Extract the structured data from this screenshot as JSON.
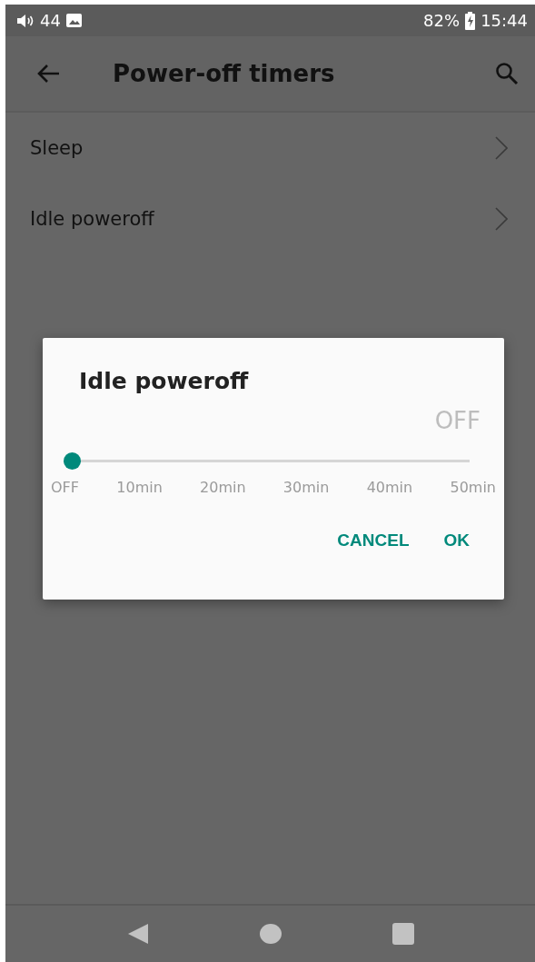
{
  "status_bar": {
    "volume": "44",
    "battery": "82%",
    "time": "15:44"
  },
  "app_bar": {
    "title": "Power-off timers"
  },
  "items": [
    {
      "label": "Sleep"
    },
    {
      "label": "Idle poweroff"
    }
  ],
  "dialog": {
    "title": "Idle poweroff",
    "value": "OFF",
    "slider": {
      "level": 0
    },
    "ticks": [
      "OFF",
      "10min",
      "20min",
      "30min",
      "40min",
      "50min"
    ],
    "buttons": [
      "CANCEL",
      "OK"
    ]
  }
}
